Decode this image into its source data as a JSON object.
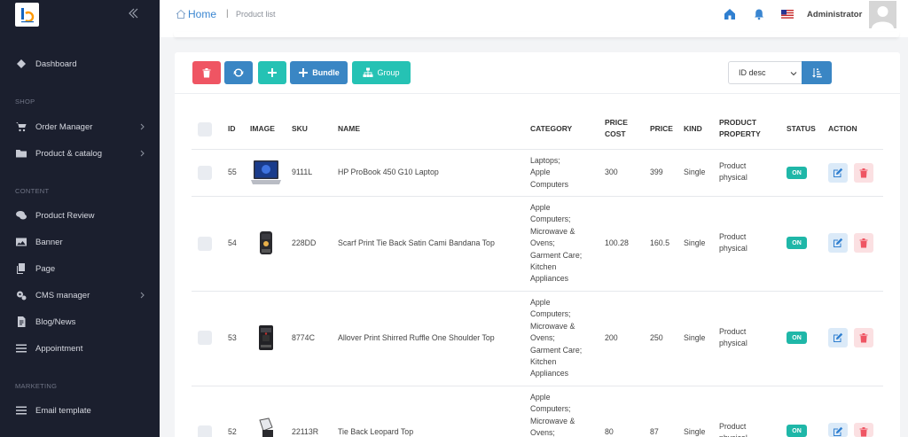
{
  "colors": {
    "sidebar_bg": "#1b1f2e",
    "accent_blue": "#3a86c4",
    "danger": "#ef5563",
    "teal": "#25c2b4",
    "status_on": "#1fb7a8"
  },
  "sidebar": {
    "dashboard": "Dashboard",
    "section_shop": "SHOP",
    "order_manager": "Order Manager",
    "product_catalog": "Product & catalog",
    "section_content": "CONTENT",
    "product_review": "Product Review",
    "banner": "Banner",
    "page": "Page",
    "cms_manager": "CMS manager",
    "blog_news": "Blog/News",
    "appointment": "Appointment",
    "section_marketing": "MARKETING",
    "email_template": "Email template"
  },
  "header": {
    "home": "Home",
    "separator": "|",
    "current": "Product list",
    "user": "Administrator"
  },
  "toolbar": {
    "bundle_label": "Bundle",
    "group_label": "Group",
    "sort_value": "ID desc"
  },
  "table": {
    "headers": {
      "id": "ID",
      "image": "IMAGE",
      "sku": "SKU",
      "name": "NAME",
      "category": "CATEGORY",
      "price_cost_1": "PRICE",
      "price_cost_2": "COST",
      "price": "PRICE",
      "kind": "KIND",
      "property_1": "PRODUCT",
      "property_2": "PROPERTY",
      "status": "STATUS",
      "action": "ACTION"
    },
    "rows": [
      {
        "id": "55",
        "sku": "9111L",
        "name": "HP ProBook 450 G10 Laptop",
        "category": [
          "Laptops;",
          "Apple",
          "Computers"
        ],
        "cost": "300",
        "price": "399",
        "kind": "Single",
        "property": [
          "Product",
          "physical"
        ],
        "status": "ON"
      },
      {
        "id": "54",
        "sku": "228DD",
        "name": "Scarf Print Tie Back Satin Cami Bandana Top",
        "category": [
          "Apple",
          "Computers;",
          "Microwave &",
          "Ovens;",
          "Garment Care;",
          "Kitchen",
          "Appliances"
        ],
        "cost": "100.28",
        "price": "160.5",
        "kind": "Single",
        "property": [
          "Product",
          "physical"
        ],
        "status": "ON"
      },
      {
        "id": "53",
        "sku": "8774C",
        "name": "Allover Print Shirred Ruffle One Shoulder Top",
        "category": [
          "Apple",
          "Computers;",
          "Microwave &",
          "Ovens;",
          "Garment Care;",
          "Kitchen",
          "Appliances"
        ],
        "cost": "200",
        "price": "250",
        "kind": "Single",
        "property": [
          "Product",
          "physical"
        ],
        "status": "ON"
      },
      {
        "id": "52",
        "sku": "22113R",
        "name": "Tie Back Leopard Top",
        "category": [
          "Apple",
          "Computers;",
          "Microwave &",
          "Ovens;"
        ],
        "cost": "80",
        "price": "87",
        "kind": "Single",
        "property": [
          "Product",
          "physical"
        ],
        "status": "ON"
      }
    ]
  }
}
